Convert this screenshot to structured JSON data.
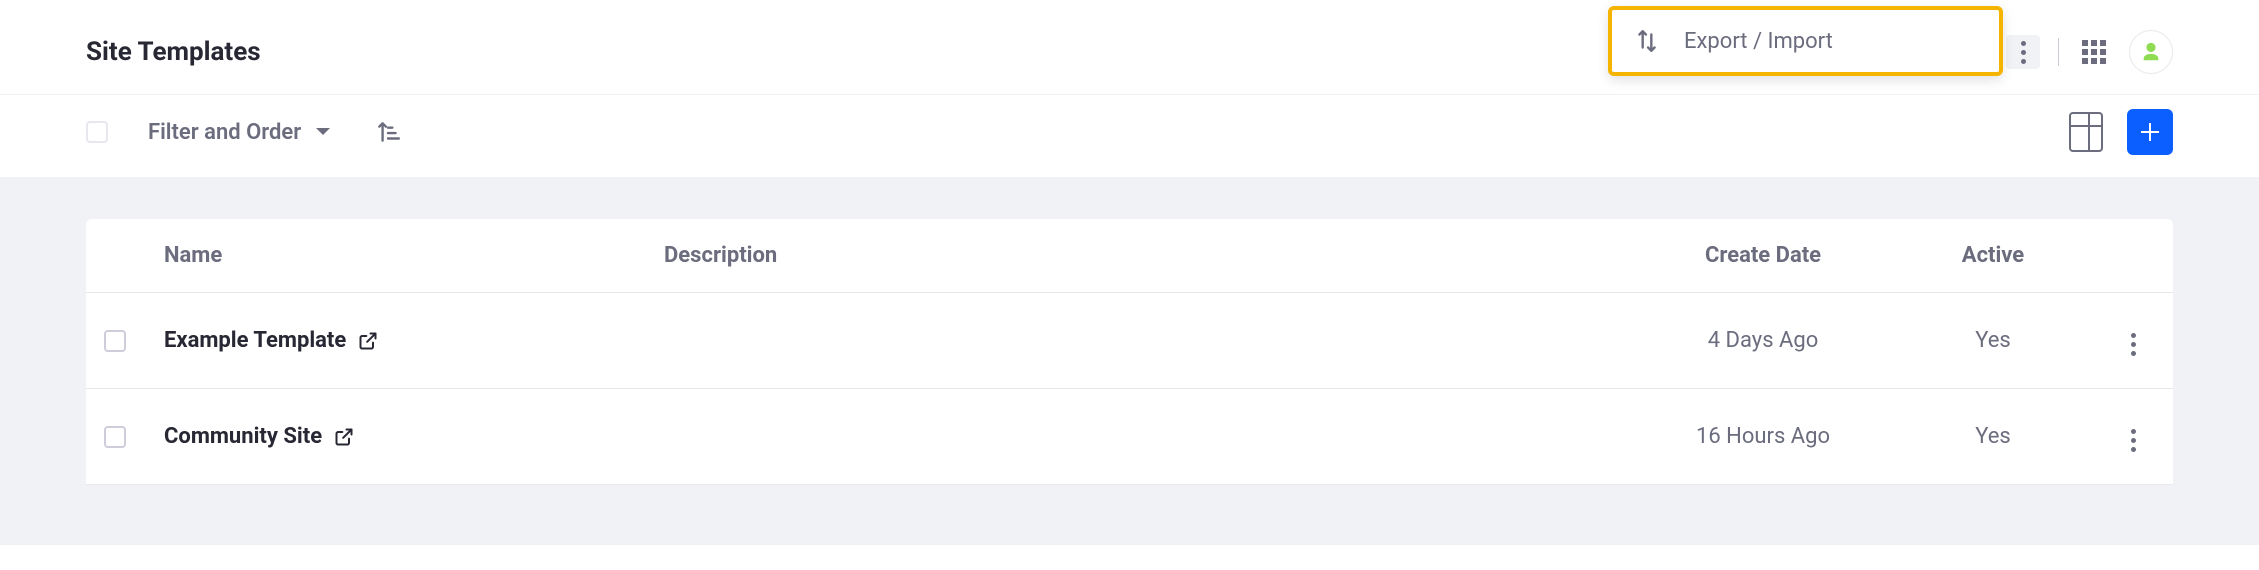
{
  "header": {
    "title": "Site Templates",
    "exportImport": "Export / Import"
  },
  "toolbar": {
    "filterLabel": "Filter and Order"
  },
  "columns": {
    "name": "Name",
    "description": "Description",
    "createDate": "Create Date",
    "active": "Active"
  },
  "rows": [
    {
      "name": "Example Template",
      "description": "",
      "createDate": "4 Days Ago",
      "active": "Yes"
    },
    {
      "name": "Community Site",
      "description": "",
      "createDate": "16 Hours Ago",
      "active": "Yes"
    }
  ]
}
